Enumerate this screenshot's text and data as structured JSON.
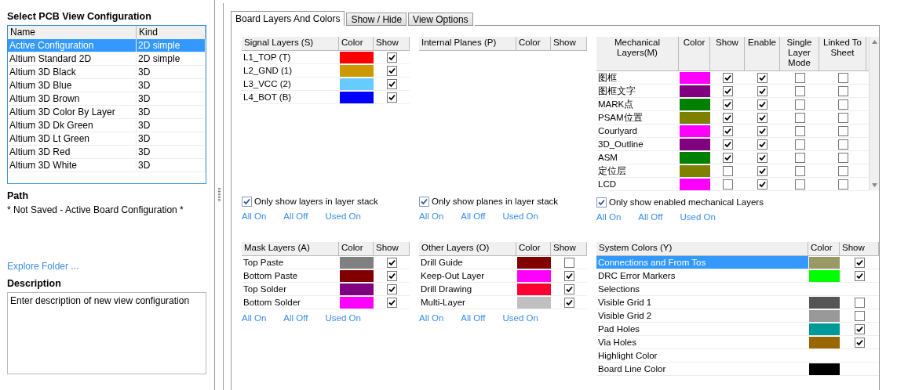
{
  "left": {
    "title": "Select PCB View Configuration",
    "list": {
      "columns": [
        "Name",
        "Kind"
      ],
      "rows": [
        {
          "name": "Active Configuration",
          "kind": "2D simple",
          "selected": true
        },
        {
          "name": "Altium Standard 2D",
          "kind": "2D simple",
          "selected": false
        },
        {
          "name": "Altium 3D Black",
          "kind": "3D",
          "selected": false
        },
        {
          "name": "Altium 3D Blue",
          "kind": "3D",
          "selected": false
        },
        {
          "name": "Altium 3D Brown",
          "kind": "3D",
          "selected": false
        },
        {
          "name": "Altium 3D Color By Layer",
          "kind": "3D",
          "selected": false
        },
        {
          "name": "Altium 3D Dk Green",
          "kind": "3D",
          "selected": false
        },
        {
          "name": "Altium 3D Lt Green",
          "kind": "3D",
          "selected": false
        },
        {
          "name": "Altium 3D Red",
          "kind": "3D",
          "selected": false
        },
        {
          "name": "Altium 3D White",
          "kind": "3D",
          "selected": false
        }
      ]
    },
    "path_label": "Path",
    "path": "* Not Saved - Active Board Configuration *",
    "explore_link": "Explore Folder ...",
    "description_label": "Description",
    "description": "Enter description of new view configuration"
  },
  "tabs": [
    {
      "label": "Board Layers And Colors",
      "selected": true
    },
    {
      "label": "Show / Hide",
      "selected": false
    },
    {
      "label": "View Options",
      "selected": false
    }
  ],
  "groups": [
    {
      "kind": "signal",
      "columns": [
        "Signal Layers (S)",
        "Color",
        "Show"
      ],
      "rows": [
        {
          "name": "L1_TOP (T)",
          "color": "#ff0000",
          "show": true
        },
        {
          "name": "L2_GND (1)",
          "color": "#cc9900",
          "show": true
        },
        {
          "name": "L3_VCC (2)",
          "color": "#66ccff",
          "show": true
        },
        {
          "name": "L4_BOT (B)",
          "color": "#0000ff",
          "show": true
        }
      ],
      "filter": {
        "label": "Only show layers in layer stack",
        "checked": true
      },
      "links": [
        "All On",
        "All Off",
        "Used On"
      ]
    },
    {
      "kind": "planes",
      "columns": [
        "Internal Planes (P)",
        "Color",
        "Show"
      ],
      "filter": {
        "label": "Only show planes in layer stack",
        "checked": true
      },
      "links": [
        "All On",
        "All Off",
        "Used On"
      ]
    },
    {
      "kind": "mechanical",
      "columns": [
        "Mechanical Layers(M)",
        "Color",
        "Show",
        "Enable",
        "Single Layer Mode",
        "Linked To Sheet"
      ],
      "rows": [
        {
          "name": "图框",
          "color": "#ff00ff",
          "show": true,
          "enable": true,
          "single_layer_mode": false,
          "linked_to_sheet": false
        },
        {
          "name": "图框文字",
          "color": "#800080",
          "show": true,
          "enable": true,
          "single_layer_mode": false,
          "linked_to_sheet": false
        },
        {
          "name": "MARK点",
          "color": "#008000",
          "show": true,
          "enable": true,
          "single_layer_mode": false,
          "linked_to_sheet": false
        },
        {
          "name": "PSAM位置",
          "color": "#808000",
          "show": true,
          "enable": true,
          "single_layer_mode": false,
          "linked_to_sheet": false
        },
        {
          "name": "Courlyard",
          "color": "#ff00ff",
          "show": true,
          "enable": true,
          "single_layer_mode": false,
          "linked_to_sheet": false
        },
        {
          "name": "3D_Outline",
          "color": "#800080",
          "show": true,
          "enable": true,
          "single_layer_mode": false,
          "linked_to_sheet": false
        },
        {
          "name": "ASM",
          "color": "#008000",
          "show": true,
          "enable": true,
          "single_layer_mode": false,
          "linked_to_sheet": false
        },
        {
          "name": "定位层",
          "color": "#808000",
          "show": false,
          "enable": true,
          "single_layer_mode": false,
          "linked_to_sheet": false
        },
        {
          "name": "LCD",
          "color": "#ff00ff",
          "show": false,
          "enable": true,
          "single_layer_mode": false,
          "linked_to_sheet": false
        }
      ],
      "filter": {
        "label": "Only show enabled mechanical Layers",
        "checked": true
      },
      "links": [
        "All On",
        "All Off",
        "Used On"
      ]
    },
    {
      "kind": "mask",
      "columns": [
        "Mask Layers (A)",
        "Color",
        "Show"
      ],
      "rows": [
        {
          "name": "Top Paste",
          "color": "#808080",
          "show": true
        },
        {
          "name": "Bottom Paste",
          "color": "#800000",
          "show": true
        },
        {
          "name": "Top Solder",
          "color": "#800080",
          "show": true
        },
        {
          "name": "Bottom Solder",
          "color": "#ff00ff",
          "show": true
        }
      ],
      "links": [
        "All On",
        "All Off",
        "Used On"
      ]
    },
    {
      "kind": "other",
      "columns": [
        "Other Layers (O)",
        "Color",
        "Show"
      ],
      "rows": [
        {
          "name": "Drill Guide",
          "color": "#800000",
          "show": false
        },
        {
          "name": "Keep-Out Layer",
          "color": "#ff00ff",
          "show": true
        },
        {
          "name": "Drill Drawing",
          "color": "#ff0033",
          "show": true
        },
        {
          "name": "Multi-Layer",
          "color": "#c0c0c0",
          "show": true
        }
      ],
      "links": [
        "All On",
        "All Off",
        "Used On"
      ]
    },
    {
      "kind": "system",
      "columns": [
        "System Colors (Y)",
        "Color",
        "Show"
      ],
      "rows": [
        {
          "name": "Connections and From Tos",
          "color": "#999966",
          "show": true,
          "selected": true
        },
        {
          "name": "DRC Error Markers",
          "color": "#00ff00",
          "show": true,
          "selected": false
        },
        {
          "name": "Selections",
          "selected": false
        },
        {
          "name": "Visible Grid 1",
          "color": "#555555",
          "show": false,
          "selected": false
        },
        {
          "name": "Visible Grid 2",
          "color": "#999999",
          "show": false,
          "selected": false
        },
        {
          "name": "Pad Holes",
          "color": "#009999",
          "show": true,
          "selected": false
        },
        {
          "name": "Via Holes",
          "color": "#996600",
          "show": true,
          "selected": false
        },
        {
          "name": "Highlight Color",
          "selected": false
        },
        {
          "name": "Board Line Color",
          "color": "#000000",
          "selected": false
        }
      ]
    }
  ]
}
